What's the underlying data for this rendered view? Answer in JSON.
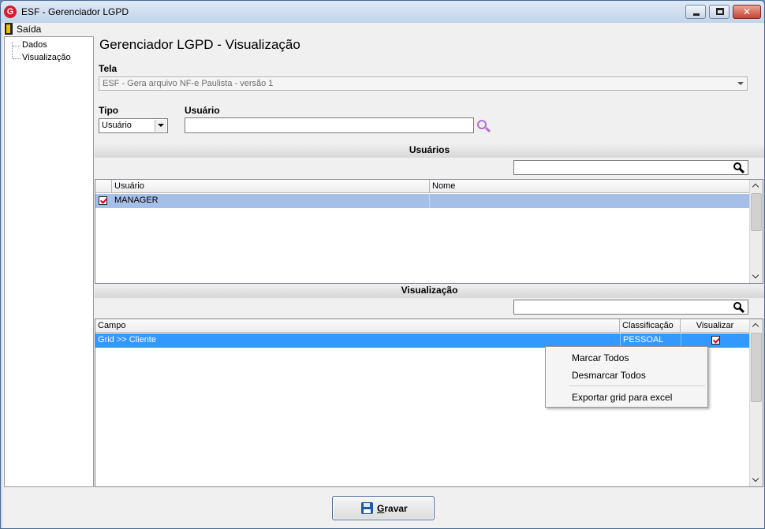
{
  "window": {
    "title": "ESF - Gerenciador LGPD",
    "logo_letter": "G"
  },
  "menu": {
    "exit_label": "Saída"
  },
  "tree": {
    "items": [
      "Dados",
      "Visualização"
    ]
  },
  "main": {
    "heading": "Gerenciador LGPD - Visualização",
    "tela_label": "Tela",
    "tela_value": "ESF - Gera arquivo NF-e Paulista - versão 1",
    "tipo_label": "Tipo",
    "tipo_value": "Usuário",
    "usuario_label": "Usuário",
    "usuario_value": ""
  },
  "users_section": {
    "title": "Usuários",
    "search_value": "",
    "columns": [
      "Usuário",
      "Nome"
    ],
    "rows": [
      {
        "checked": true,
        "usuario": "MANAGER",
        "nome": ""
      }
    ]
  },
  "view_section": {
    "title": "Visualização",
    "search_value": "",
    "columns": [
      "Campo",
      "Classificação",
      "Visualizar"
    ],
    "rows": [
      {
        "campo": "Grid >> Cliente",
        "classificacao": "PESSOAL",
        "visualizar": true
      }
    ]
  },
  "context_menu": {
    "items": [
      "Marcar Todos",
      "Desmarcar Todos",
      "Exportar grid para excel"
    ]
  },
  "footer": {
    "save_label_accel": "G",
    "save_label_rest": "ravar"
  },
  "colors": {
    "selected_row_users": "#a6bfe8",
    "selected_row_view": "#3399ff",
    "checkmark": "#e0001a"
  }
}
